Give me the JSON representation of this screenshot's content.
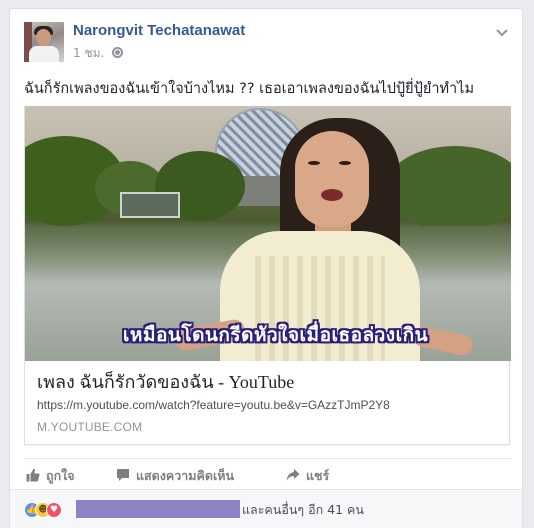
{
  "post": {
    "author": "Narongvit Techatanawat",
    "time": "1 ชม.",
    "privacy_icon": "globe-icon",
    "text": "ฉันก็รักเพลงของฉันเข้าใจบ้างไหม ?? เธอเอาเพลงของฉันไปปู้ยี่ปู้ยำทำไม"
  },
  "attachment": {
    "video_subtitle": "เหมือนโดนกรีดหัวใจเมื่อเธอล่วงเกิน",
    "title": "เพลง ฉันก็รักวัดของฉัน - YouTube",
    "url": "https://m.youtube.com/watch?feature=youtu.be&v=GAzzTJmP2Y8",
    "domain": "M.YOUTUBE.COM"
  },
  "actions": {
    "like": "ถูกใจ",
    "comment": "แสดงความคิดเห็น",
    "share": "แชร์"
  },
  "reactions": {
    "summary": "และคนอื่นๆ อีก 41 คน",
    "icons": [
      "like-icon",
      "haha-icon",
      "love-icon"
    ]
  },
  "colors": {
    "author": "#365899",
    "action": "#7f7f7f",
    "like": "#5890ff",
    "love": "#f25268",
    "haha": "#f7c735"
  }
}
